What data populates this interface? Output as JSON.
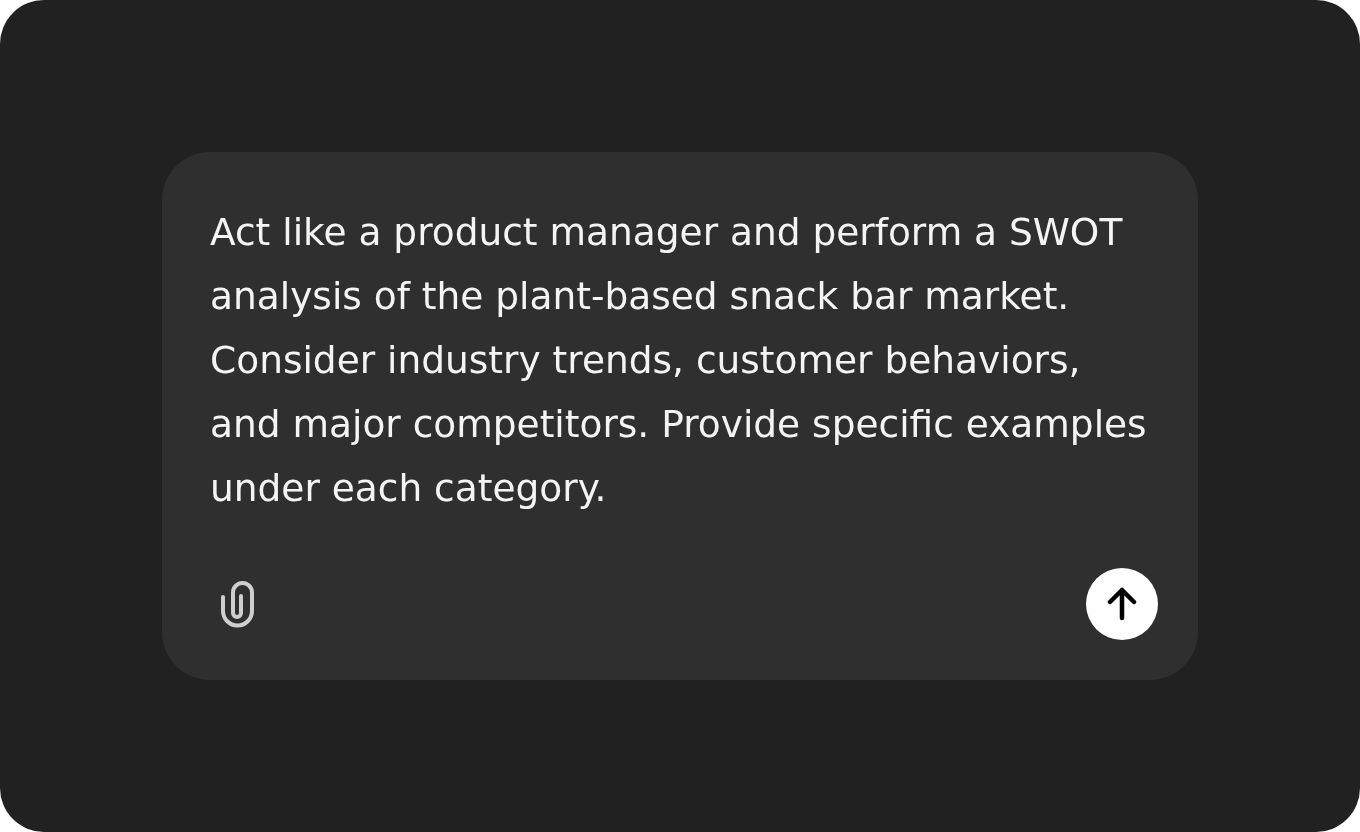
{
  "prompt": {
    "value": "Act like a product manager and perform a SWOT\nanalysis of the plant-based snack bar market.\nConsider industry trends, customer behaviors,\nand major competitors. Provide specific examples\nunder each category."
  }
}
